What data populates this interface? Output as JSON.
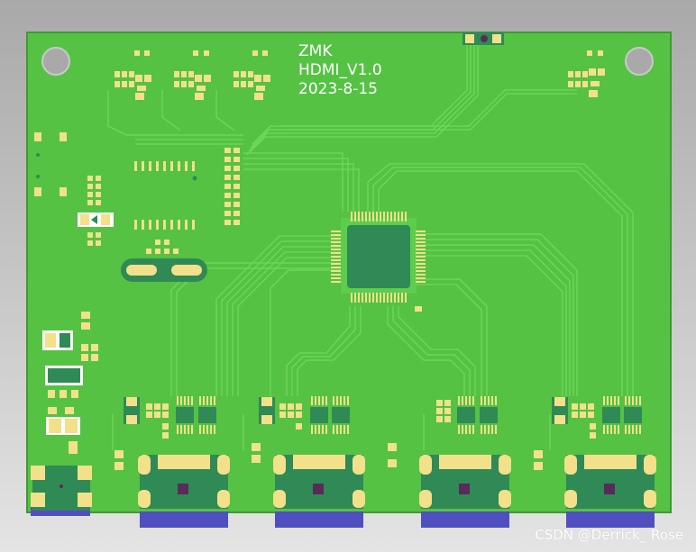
{
  "board": {
    "silkscreen": {
      "line1": "ZMK",
      "line2": "HDMI_V1.0",
      "line3": "2023-8-15"
    },
    "colors": {
      "board": "#55c244",
      "board_edge": "#3f9a34",
      "trace": "#6fd85a",
      "pad": "#f2e08a",
      "chip": "#2f8a55",
      "connector": "#4f4fbf"
    },
    "component_summary": {
      "hdmi_connectors": 5,
      "main_ic": 1,
      "mounting_holes": 2
    }
  },
  "watermark": "CSDN @Derrick_ Rose"
}
